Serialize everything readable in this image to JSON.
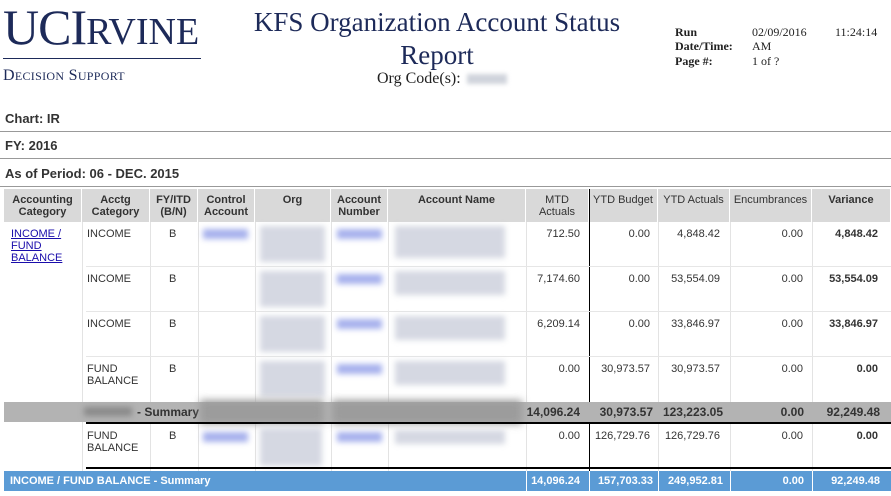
{
  "header": {
    "logo_uc": "UC",
    "logo_i": "I",
    "logo_rvine": "RVINE",
    "logo_sub_d": "D",
    "logo_sub_ecision": "ECISION",
    "logo_sub_s": "S",
    "logo_sub_upport": "UPPORT",
    "title": "KFS Organization Account Status Report",
    "org_code_label": "Org Code(s):"
  },
  "meta": {
    "run_label": "Run",
    "datetime_label": "Date/Time:",
    "page_label": "Page #:",
    "run_date": "02/09/2016",
    "run_time": "11:24:14",
    "run_ampm": "AM",
    "page_value": "1 of ?"
  },
  "info": {
    "chart": "Chart: IR",
    "fy": "FY: 2016",
    "period": "As of Period: 06 - DEC. 2015"
  },
  "columns": {
    "accounting_category": "Accounting Category",
    "acctg_category": "Acctg Category",
    "fy_itd": "FY/ITD (B/N)",
    "control_account": "Control Account",
    "org": "Org",
    "account_number": "Account Number",
    "account_name": "Account Name",
    "mtd_actuals": "MTD Actuals",
    "ytd_budget": "YTD Budget",
    "ytd_actuals": "YTD Actuals",
    "encumbrances": "Encumbrances",
    "variance": "Variance"
  },
  "group_label": "INCOME / FUND BALANCE",
  "rows": [
    {
      "acctg": "INCOME",
      "fy": "B",
      "mtd": "712.50",
      "budget": "0.00",
      "ytd": "4,848.42",
      "enc": "0.00",
      "var": "4,848.42"
    },
    {
      "acctg": "INCOME",
      "fy": "B",
      "mtd": "7,174.60",
      "budget": "0.00",
      "ytd": "53,554.09",
      "enc": "0.00",
      "var": "53,554.09"
    },
    {
      "acctg": "INCOME",
      "fy": "B",
      "mtd": "6,209.14",
      "budget": "0.00",
      "ytd": "33,846.97",
      "enc": "0.00",
      "var": "33,846.97"
    },
    {
      "acctg": "FUND BALANCE",
      "fy": "B",
      "mtd": "0.00",
      "budget": "30,973.57",
      "ytd": "30,973.57",
      "enc": "0.00",
      "var": "0.00"
    }
  ],
  "summary": {
    "label": "- Summary",
    "mtd": "14,096.24",
    "budget": "30,973.57",
    "ytd": "123,223.05",
    "enc": "0.00",
    "var": "92,249.48"
  },
  "row5": {
    "acctg": "FUND BALANCE",
    "fy": "B",
    "mtd": "0.00",
    "budget": "126,729.76",
    "ytd": "126,729.76",
    "enc": "0.00",
    "var": "0.00"
  },
  "total": {
    "label": "INCOME / FUND BALANCE - Summary",
    "mtd": "14,096.24",
    "budget": "157,703.33",
    "ytd": "249,952.81",
    "enc": "0.00",
    "var": "92,249.48"
  }
}
